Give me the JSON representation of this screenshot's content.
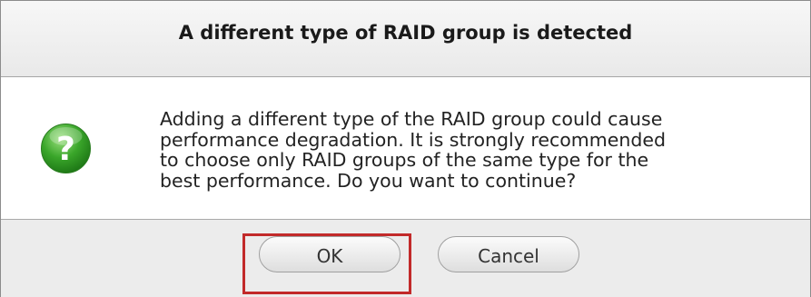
{
  "dialog": {
    "title": "A different type of RAID group is detected",
    "message": "Adding a different type of the RAID group could cause\nperformance degradation. It is strongly recommended\nto choose only RAID groups of the same type for the\nbest performance. Do you want to continue?",
    "icon": "question-mark-icon",
    "icon_glyph": "?",
    "buttons": {
      "ok_label": "OK",
      "cancel_label": "Cancel"
    }
  },
  "colors": {
    "icon_green": "#3aa62a",
    "highlight_red": "#c22a2a"
  }
}
